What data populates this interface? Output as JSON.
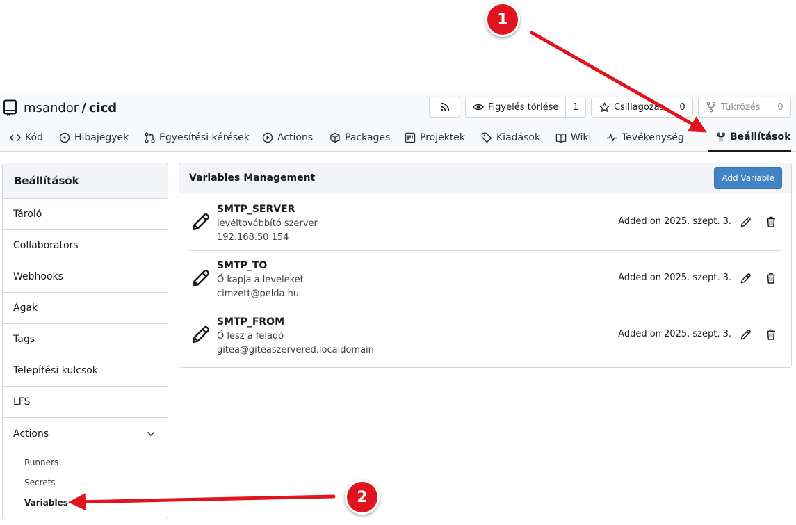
{
  "repo": {
    "owner": "msandor",
    "separator": "/",
    "name": "cicd"
  },
  "header_buttons": {
    "rss_icon": "rss-icon",
    "watch": {
      "label": "Figyelés törlése",
      "count": "1",
      "icon": "eye-icon"
    },
    "star": {
      "label": "Csillagozás",
      "count": "0",
      "icon": "star-icon"
    },
    "fork": {
      "label": "Tükrözés",
      "count": "0",
      "icon": "fork-icon"
    }
  },
  "tabs": [
    {
      "label": "Kód",
      "icon": "code-icon"
    },
    {
      "label": "Hibajegyek",
      "icon": "issue-icon"
    },
    {
      "label": "Egyesítési kérések",
      "icon": "pull-request-icon"
    },
    {
      "label": "Actions",
      "icon": "play-icon"
    },
    {
      "label": "Packages",
      "icon": "package-icon"
    },
    {
      "label": "Projektek",
      "icon": "project-icon"
    },
    {
      "label": "Kiadások",
      "icon": "tag-icon"
    },
    {
      "label": "Wiki",
      "icon": "book-icon"
    },
    {
      "label": "Tevékenység",
      "icon": "pulse-icon"
    },
    {
      "label": "Beállítások",
      "icon": "tools-icon",
      "active": true
    }
  ],
  "sidebar": {
    "title": "Beállítások",
    "items": [
      {
        "label": "Tároló"
      },
      {
        "label": "Collaborators"
      },
      {
        "label": "Webhooks"
      },
      {
        "label": "Ágak"
      },
      {
        "label": "Tags"
      },
      {
        "label": "Telepítési kulcsok"
      },
      {
        "label": "LFS"
      }
    ],
    "actions_group": {
      "label": "Actions",
      "children": [
        {
          "label": "Runners"
        },
        {
          "label": "Secrets"
        },
        {
          "label": "Variables",
          "active": true
        }
      ]
    }
  },
  "main": {
    "title": "Variables Management",
    "add_button": "Add Variable",
    "variables": [
      {
        "name": "SMTP_SERVER",
        "description": "levéltovábbító szerver",
        "value": "192.168.50.154",
        "added": "Added on 2025. szept. 3."
      },
      {
        "name": "SMTP_TO",
        "description": "Ő kapja a leveleket",
        "value": "cimzett@pelda.hu",
        "added": "Added on 2025. szept. 3."
      },
      {
        "name": "SMTP_FROM",
        "description": "Ő lesz a feladó",
        "value": "gitea@giteaszervered.localdomain",
        "added": "Added on 2025. szept. 3."
      }
    ]
  },
  "annotations": [
    {
      "label": "1"
    },
    {
      "label": "2"
    }
  ],
  "colors": {
    "accent_button": "#4183c4",
    "annotation_red": "#e0141e",
    "border": "#d0d7de"
  }
}
